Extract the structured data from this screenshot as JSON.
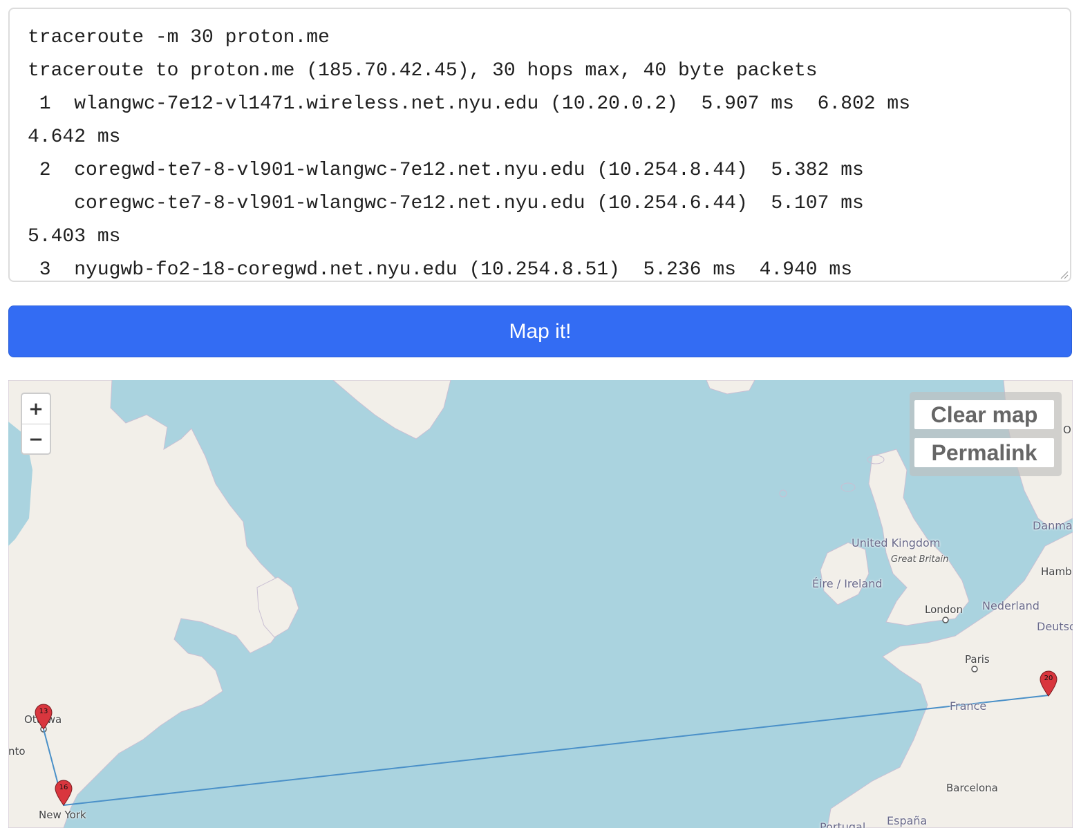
{
  "trace": {
    "lines": [
      "traceroute -m 30 proton.me",
      "traceroute to proton.me (185.70.42.45), 30 hops max, 40 byte packets",
      " 1  wlangwc-7e12-vl1471.wireless.net.nyu.edu (10.20.0.2)  5.907 ms  6.802 ms",
      "4.642 ms",
      " 2  coregwd-te7-8-vl901-wlangwc-7e12.net.nyu.edu (10.254.8.44)  5.382 ms",
      "    coregwc-te7-8-vl901-wlangwc-7e12.net.nyu.edu (10.254.6.44)  5.107 ms",
      "5.403 ms",
      " 3  nyugwb-fo2-18-coregwd.net.nyu.edu (10.254.8.51)  5.236 ms  4.940 ms"
    ]
  },
  "submit": {
    "label": "Map it!"
  },
  "map": {
    "zoom_in": "+",
    "zoom_out": "−",
    "clear_label": "Clear map",
    "permalink_label": "Permalink",
    "places": {
      "uk": "United Kingdom",
      "gb": "Great Britain",
      "ireland": "Éire / Ireland",
      "london": "London",
      "nederland": "Nederland",
      "deutsch": "Deutsc",
      "danmark": "Danma",
      "hamburg": "Hamb",
      "paris": "Paris",
      "france": "France",
      "barcelona": "Barcelona",
      "espana": "España",
      "portugal": "Portugal",
      "ottawa": "Ottawa",
      "toronto": "nto",
      "newyork": "New York",
      "oslo": "O"
    },
    "markers": [
      {
        "label": "13"
      },
      {
        "label": "16"
      },
      {
        "label": "20"
      }
    ],
    "marker_color": "#d9363e",
    "route_color": "#4a90c8"
  }
}
